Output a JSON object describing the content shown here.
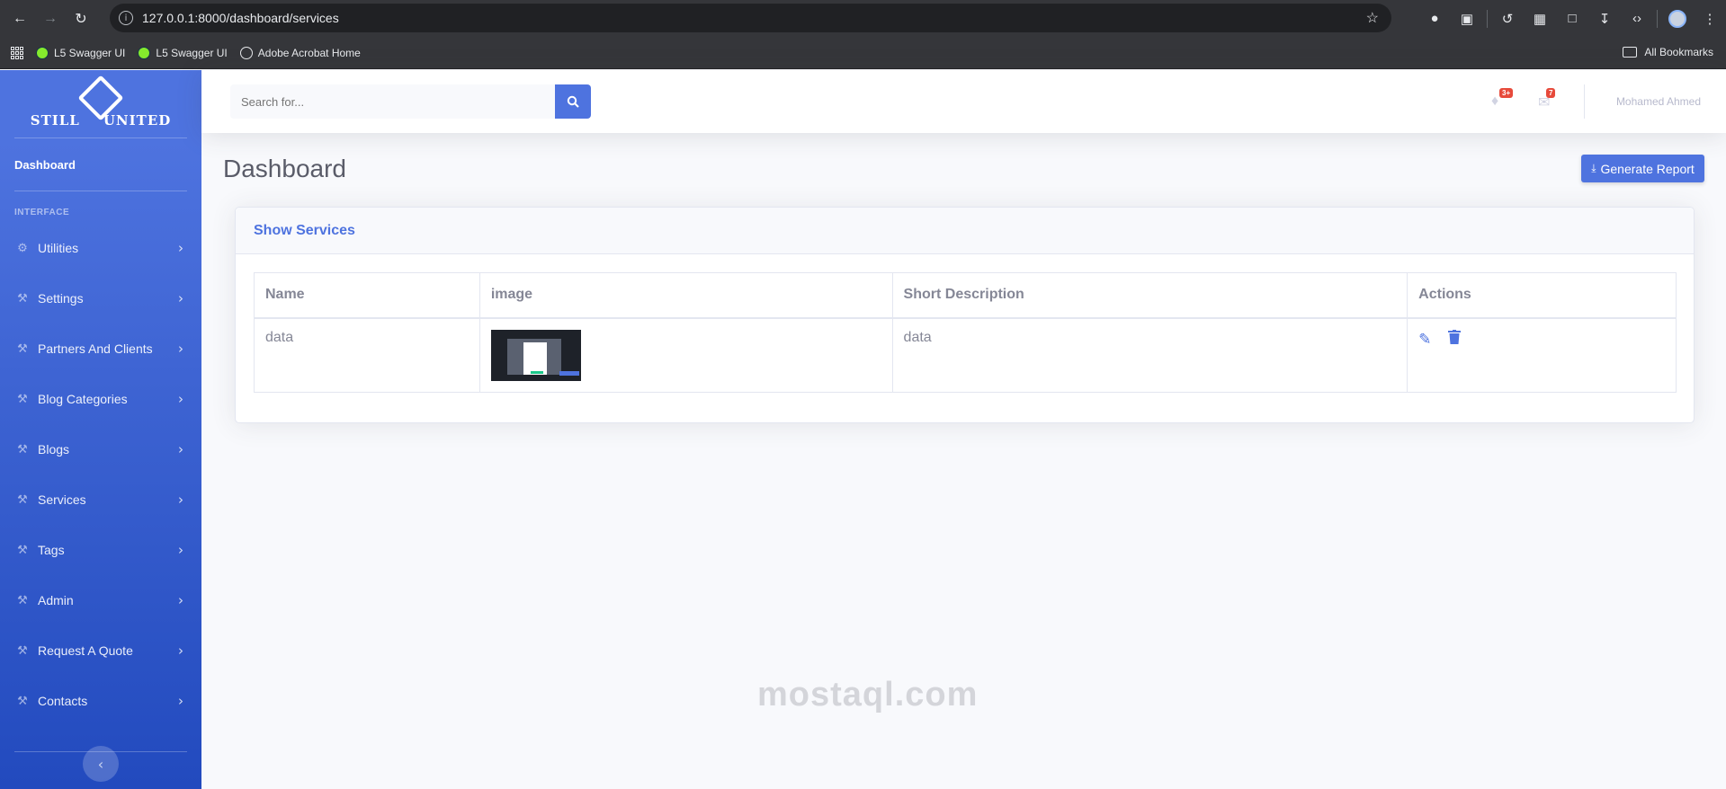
{
  "browser": {
    "url": "127.0.0.1:8000/dashboard/services",
    "bookmarks": [
      "L5 Swagger UI",
      "L5 Swagger UI",
      "Adobe Acrobat Home"
    ],
    "all_bookmarks": "All Bookmarks"
  },
  "sidebar": {
    "brand_left": "STILL",
    "brand_right": "UNITED",
    "dashboard": "Dashboard",
    "section_heading": "INTERFACE",
    "items": [
      {
        "label": "Utilities",
        "icon": "gear-icon"
      },
      {
        "label": "Settings",
        "icon": "wrench-icon"
      },
      {
        "label": "Partners And Clients",
        "icon": "wrench-icon"
      },
      {
        "label": "Blog Categories",
        "icon": "wrench-icon"
      },
      {
        "label": "Blogs",
        "icon": "wrench-icon"
      },
      {
        "label": "Services",
        "icon": "wrench-icon"
      },
      {
        "label": "Tags",
        "icon": "wrench-icon"
      },
      {
        "label": "Admin",
        "icon": "wrench-icon"
      },
      {
        "label": "Request A Quote",
        "icon": "wrench-icon"
      },
      {
        "label": "Contacts",
        "icon": "wrench-icon"
      }
    ]
  },
  "topbar": {
    "search_placeholder": "Search for...",
    "alerts_count": "3+",
    "messages_count": "7",
    "user_name": "Mohamed Ahmed"
  },
  "page": {
    "title": "Dashboard",
    "generate_report": "Generate Report"
  },
  "card": {
    "title": "Show Services",
    "columns": [
      "Name",
      "image",
      "Short Description",
      "Actions"
    ],
    "rows": [
      {
        "name": "data",
        "short_description": "data"
      }
    ]
  },
  "watermark": {
    "latin": "mostaql.com"
  },
  "colors": {
    "primary": "#4e73df",
    "danger": "#e74a3b",
    "background": "#f8f9fc"
  }
}
